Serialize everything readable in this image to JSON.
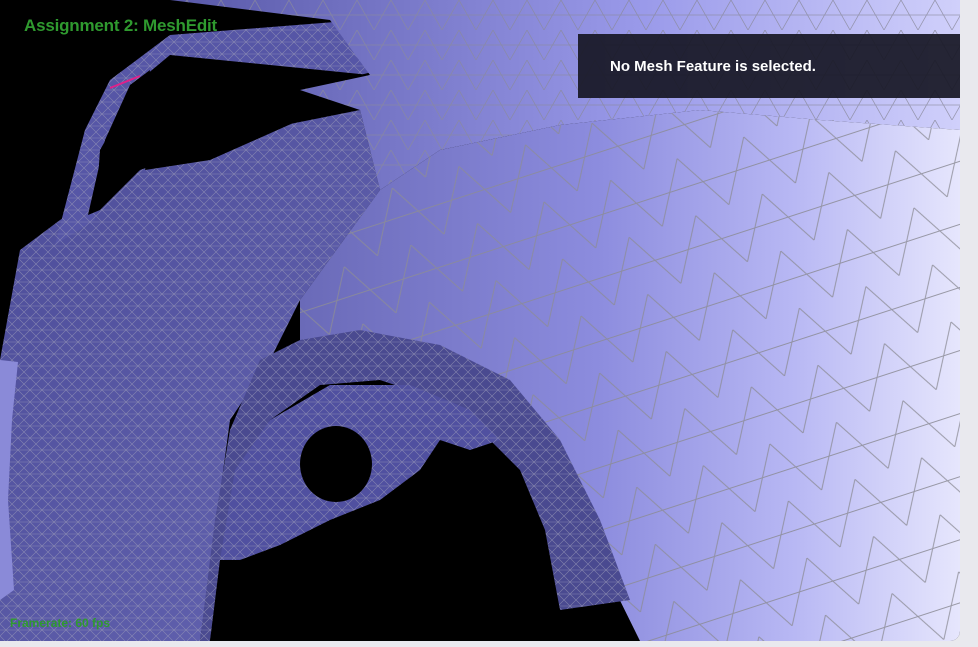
{
  "app": {
    "title": "Assignment 2: MeshEdit"
  },
  "info_panel": {
    "message": "No Mesh Feature is selected."
  },
  "status": {
    "fps": "Framerate: 60 fps"
  },
  "colors": {
    "title_green": "#2f9a2f",
    "panel_bg": "#181826",
    "mesh_dark": "#5a5aa8",
    "mesh_light": "#d8d8fb",
    "wire": "#8a8a8a",
    "selection_edge": "#e0208a"
  }
}
